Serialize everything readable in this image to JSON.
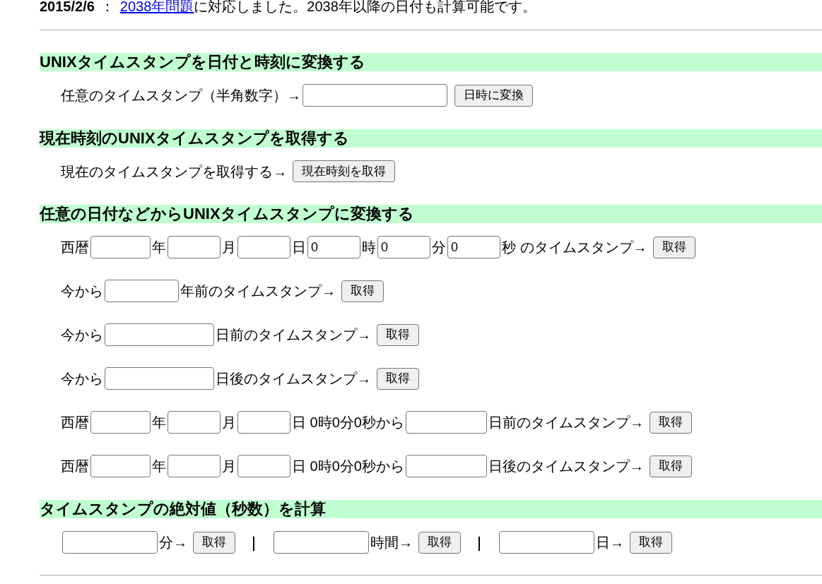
{
  "notice": {
    "date": "2015/2/6",
    "separator": "：",
    "link": "2038年問題",
    "text": "に対応しました。2038年以降の日付も計算可能です。"
  },
  "sections": [
    {
      "heading": "UNIXタイムスタンプを日付と時刻に変換する",
      "lines": [
        {
          "parts": [
            {
              "kind": "text",
              "text": "任意のタイムスタンプ（半角数字）→"
            },
            {
              "kind": "field"
            },
            {
              "kind": "button",
              "text": "日時に変換"
            }
          ]
        }
      ]
    },
    {
      "heading": "現在時刻のUNIXタイムスタンプを取得する",
      "lines": [
        {
          "parts": [
            {
              "kind": "text",
              "text": "現在のタイムスタンプを取得する→"
            },
            {
              "kind": "button",
              "text": "現在時刻を取得"
            }
          ]
        }
      ]
    },
    {
      "heading": "任意の日付などからUNIXタイムスタンプに変換する",
      "lines": [
        {
          "parts": [
            {
              "kind": "text",
              "text": "西暦"
            },
            {
              "kind": "field"
            },
            {
              "kind": "text",
              "text": "年"
            },
            {
              "kind": "field"
            },
            {
              "kind": "text",
              "text": "月"
            },
            {
              "kind": "field"
            },
            {
              "kind": "text",
              "text": "日"
            },
            {
              "kind": "field",
              "value": "0"
            },
            {
              "kind": "text",
              "text": "時"
            },
            {
              "kind": "field",
              "value": "0"
            },
            {
              "kind": "text",
              "text": "分"
            },
            {
              "kind": "field",
              "value": "0"
            },
            {
              "kind": "text",
              "text": "秒 のタイムスタンプ→"
            },
            {
              "kind": "button",
              "text": "取得"
            }
          ]
        },
        {
          "parts": [
            {
              "kind": "text",
              "text": "今から"
            },
            {
              "kind": "field"
            },
            {
              "kind": "text",
              "text": "年前のタイムスタンプ→"
            },
            {
              "kind": "button",
              "text": "取得"
            }
          ]
        },
        {
          "parts": [
            {
              "kind": "text",
              "text": "今から"
            },
            {
              "kind": "field"
            },
            {
              "kind": "text",
              "text": "日前のタイムスタンプ→"
            },
            {
              "kind": "button",
              "text": "取得"
            }
          ]
        },
        {
          "parts": [
            {
              "kind": "text",
              "text": "今から"
            },
            {
              "kind": "field"
            },
            {
              "kind": "text",
              "text": "日後のタイムスタンプ→"
            },
            {
              "kind": "button",
              "text": "取得"
            }
          ]
        },
        {
          "parts": [
            {
              "kind": "text",
              "text": "西暦"
            },
            {
              "kind": "field"
            },
            {
              "kind": "text",
              "text": "年"
            },
            {
              "kind": "field"
            },
            {
              "kind": "text",
              "text": "月"
            },
            {
              "kind": "field"
            },
            {
              "kind": "text",
              "text": "日 0時0分0秒から"
            },
            {
              "kind": "field"
            },
            {
              "kind": "text",
              "text": "日前のタイムスタンプ→"
            },
            {
              "kind": "button",
              "text": "取得"
            }
          ]
        },
        {
          "parts": [
            {
              "kind": "text",
              "text": "西暦"
            },
            {
              "kind": "field"
            },
            {
              "kind": "text",
              "text": "年"
            },
            {
              "kind": "field"
            },
            {
              "kind": "text",
              "text": "月"
            },
            {
              "kind": "field"
            },
            {
              "kind": "text",
              "text": "日 0時0分0秒から"
            },
            {
              "kind": "field"
            },
            {
              "kind": "text",
              "text": "日後のタイムスタンプ→"
            },
            {
              "kind": "button",
              "text": "取得"
            }
          ]
        }
      ]
    },
    {
      "heading": "タイムスタンプの絶対値（秒数）を計算",
      "lines": [
        {
          "parts": [
            {
              "kind": "field"
            },
            {
              "kind": "text",
              "text": "分→"
            },
            {
              "kind": "button",
              "text": "取得"
            },
            {
              "kind": "separator",
              "text": "｜"
            },
            {
              "kind": "field"
            },
            {
              "kind": "text",
              "text": "時間→"
            },
            {
              "kind": "button",
              "text": "取得"
            },
            {
              "kind": "separator",
              "text": "｜"
            },
            {
              "kind": "field"
            },
            {
              "kind": "text",
              "text": "日→"
            },
            {
              "kind": "button",
              "text": "取得"
            }
          ]
        }
      ]
    }
  ]
}
